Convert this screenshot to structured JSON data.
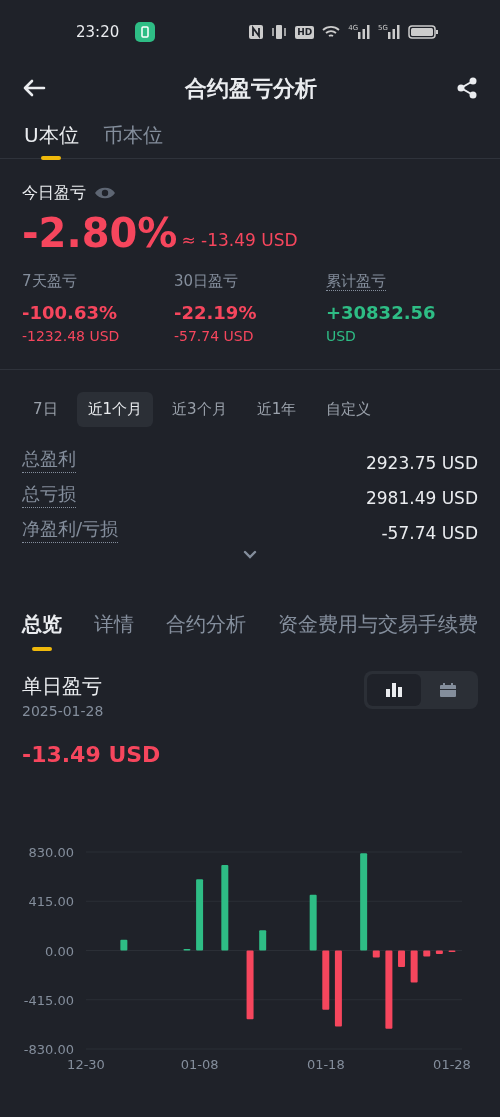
{
  "status_bar": {
    "time": "23:20",
    "hd_label": "HD",
    "networks": [
      "4G",
      "5G"
    ]
  },
  "header": {
    "title": "合约盈亏分析"
  },
  "currency_tabs": [
    {
      "label": "U本位",
      "selected": true
    },
    {
      "label": "币本位",
      "selected": false
    }
  ],
  "today": {
    "label": "今日盈亏",
    "percent": "-2.80%",
    "approx": "≈ -13.49 USD",
    "kind": "loss"
  },
  "stats": [
    {
      "label": "7天盈亏",
      "value": "-100.63%",
      "usd": "-1232.48 USD",
      "kind": "loss",
      "dotted_underline": false
    },
    {
      "label": "30日盈亏",
      "value": "-22.19%",
      "usd": "-57.74 USD",
      "kind": "loss",
      "dotted_underline": false
    },
    {
      "label": "累计盈亏",
      "value": "+30832.56",
      "usd": "USD",
      "kind": "profit",
      "dotted_underline": true
    }
  ],
  "periods": [
    {
      "label": "7日",
      "selected": false
    },
    {
      "label": "近1个月",
      "selected": true
    },
    {
      "label": "近3个月",
      "selected": false
    },
    {
      "label": "近1年",
      "selected": false
    },
    {
      "label": "自定义",
      "selected": false
    }
  ],
  "summary": [
    {
      "label": "总盈利",
      "value": "2923.75 USD"
    },
    {
      "label": "总亏损",
      "value": "2981.49 USD"
    },
    {
      "label": "净盈利/亏损",
      "value": "-57.74 USD"
    }
  ],
  "section_tabs": [
    {
      "label": "总览",
      "selected": true
    },
    {
      "label": "详情",
      "selected": false
    },
    {
      "label": "合约分析",
      "selected": false
    },
    {
      "label": "资金费用与交易手续费",
      "selected": false
    }
  ],
  "daily": {
    "title": "单日盈亏",
    "date": "2025-01-28",
    "value": "-13.49 USD",
    "kind": "loss",
    "view_modes": [
      {
        "kind": "bars",
        "selected": true
      },
      {
        "kind": "calendar",
        "selected": false
      }
    ],
    "chart_data": {
      "type": "bar",
      "grid": true,
      "categories": [
        "12-30",
        null,
        null,
        null,
        null,
        null,
        null,
        null,
        null,
        "01-08",
        null,
        null,
        null,
        null,
        null,
        null,
        null,
        null,
        null,
        "01-18",
        null,
        null,
        null,
        null,
        null,
        null,
        null,
        null,
        null,
        "01-28"
      ],
      "series": [
        {
          "color": "#2ebd85",
          "values": [
            null,
            null,
            null,
            90,
            null,
            null,
            null,
            null,
            10,
            600,
            null,
            720,
            null,
            null,
            170,
            null,
            null,
            null,
            470,
            null,
            null,
            null,
            820,
            null,
            null,
            null,
            null,
            null,
            null,
            null
          ]
        },
        {
          "color": "#f6465d",
          "values": [
            null,
            null,
            null,
            null,
            null,
            null,
            null,
            null,
            null,
            null,
            null,
            null,
            null,
            -580,
            null,
            null,
            null,
            null,
            null,
            -500,
            -640,
            null,
            null,
            -60,
            -660,
            -140,
            -270,
            -50,
            -30,
            -10
          ]
        }
      ],
      "ylim": [
        -830,
        830
      ],
      "yticks": [
        {
          "value": 830,
          "label": "830.00"
        },
        {
          "value": 415,
          "label": "415.00"
        },
        {
          "value": 0,
          "label": "0.00"
        },
        {
          "value": -415,
          "label": "-415.00"
        },
        {
          "value": -830,
          "label": "-830.00"
        }
      ]
    }
  }
}
